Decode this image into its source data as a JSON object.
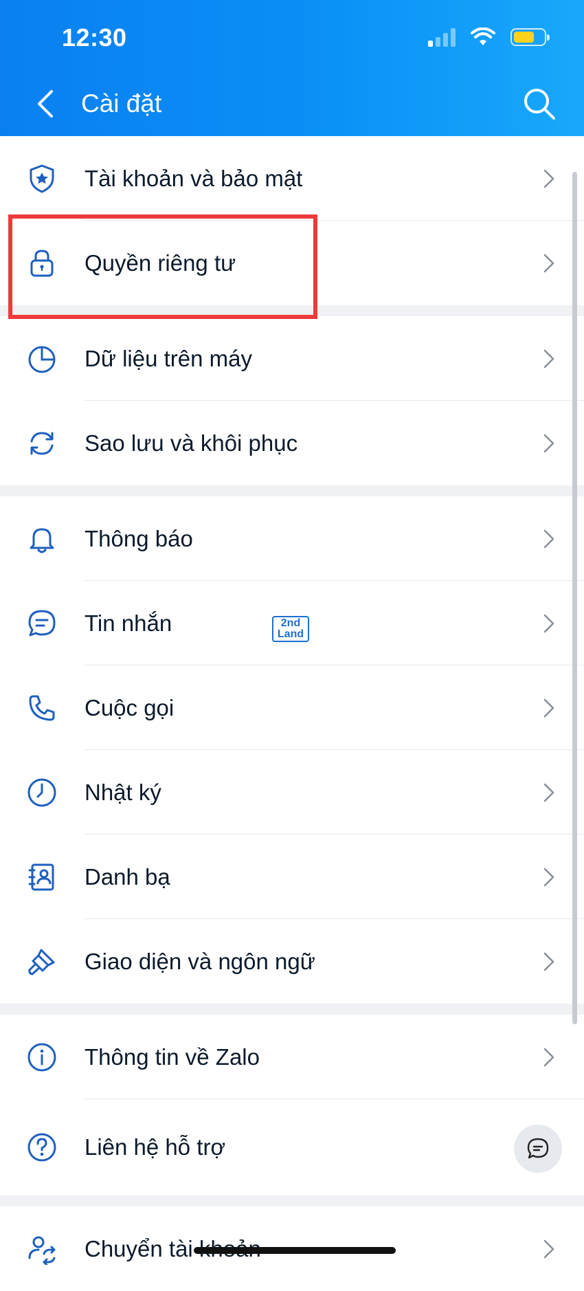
{
  "status_bar": {
    "time": "12:30"
  },
  "header": {
    "title": "Cài đặt"
  },
  "groups": [
    {
      "items": [
        {
          "label": "Tài khoản và bảo mật",
          "icon": "shield-star-icon"
        },
        {
          "label": "Quyền riêng tư",
          "icon": "lock-icon"
        }
      ]
    },
    {
      "items": [
        {
          "label": "Dữ liệu trên máy",
          "icon": "pie-chart-icon"
        },
        {
          "label": "Sao lưu và khôi phục",
          "icon": "sync-icon"
        }
      ]
    },
    {
      "items": [
        {
          "label": "Thông báo",
          "icon": "bell-icon"
        },
        {
          "label": "Tin nhắn",
          "icon": "chat-bubble-icon"
        },
        {
          "label": "Cuộc gọi",
          "icon": "phone-icon"
        },
        {
          "label": "Nhật ký",
          "icon": "clock-icon"
        },
        {
          "label": "Danh bạ",
          "icon": "contact-book-icon"
        },
        {
          "label": "Giao diện và ngôn ngữ",
          "icon": "paint-brush-icon"
        }
      ]
    },
    {
      "items": [
        {
          "label": "Thông tin về Zalo",
          "icon": "info-icon"
        },
        {
          "label": "Liên hệ hỗ trợ",
          "icon": "help-icon"
        }
      ]
    },
    {
      "items": [
        {
          "label": "Chuyển tài khoản",
          "icon": "switch-account-icon"
        }
      ]
    }
  ],
  "watermark": {
    "line1": "2nd",
    "line2": "Land"
  },
  "colors": {
    "header": "#0a8ef6",
    "accent_icon": "#1d5fbf",
    "highlight": "#ee3a3a"
  }
}
